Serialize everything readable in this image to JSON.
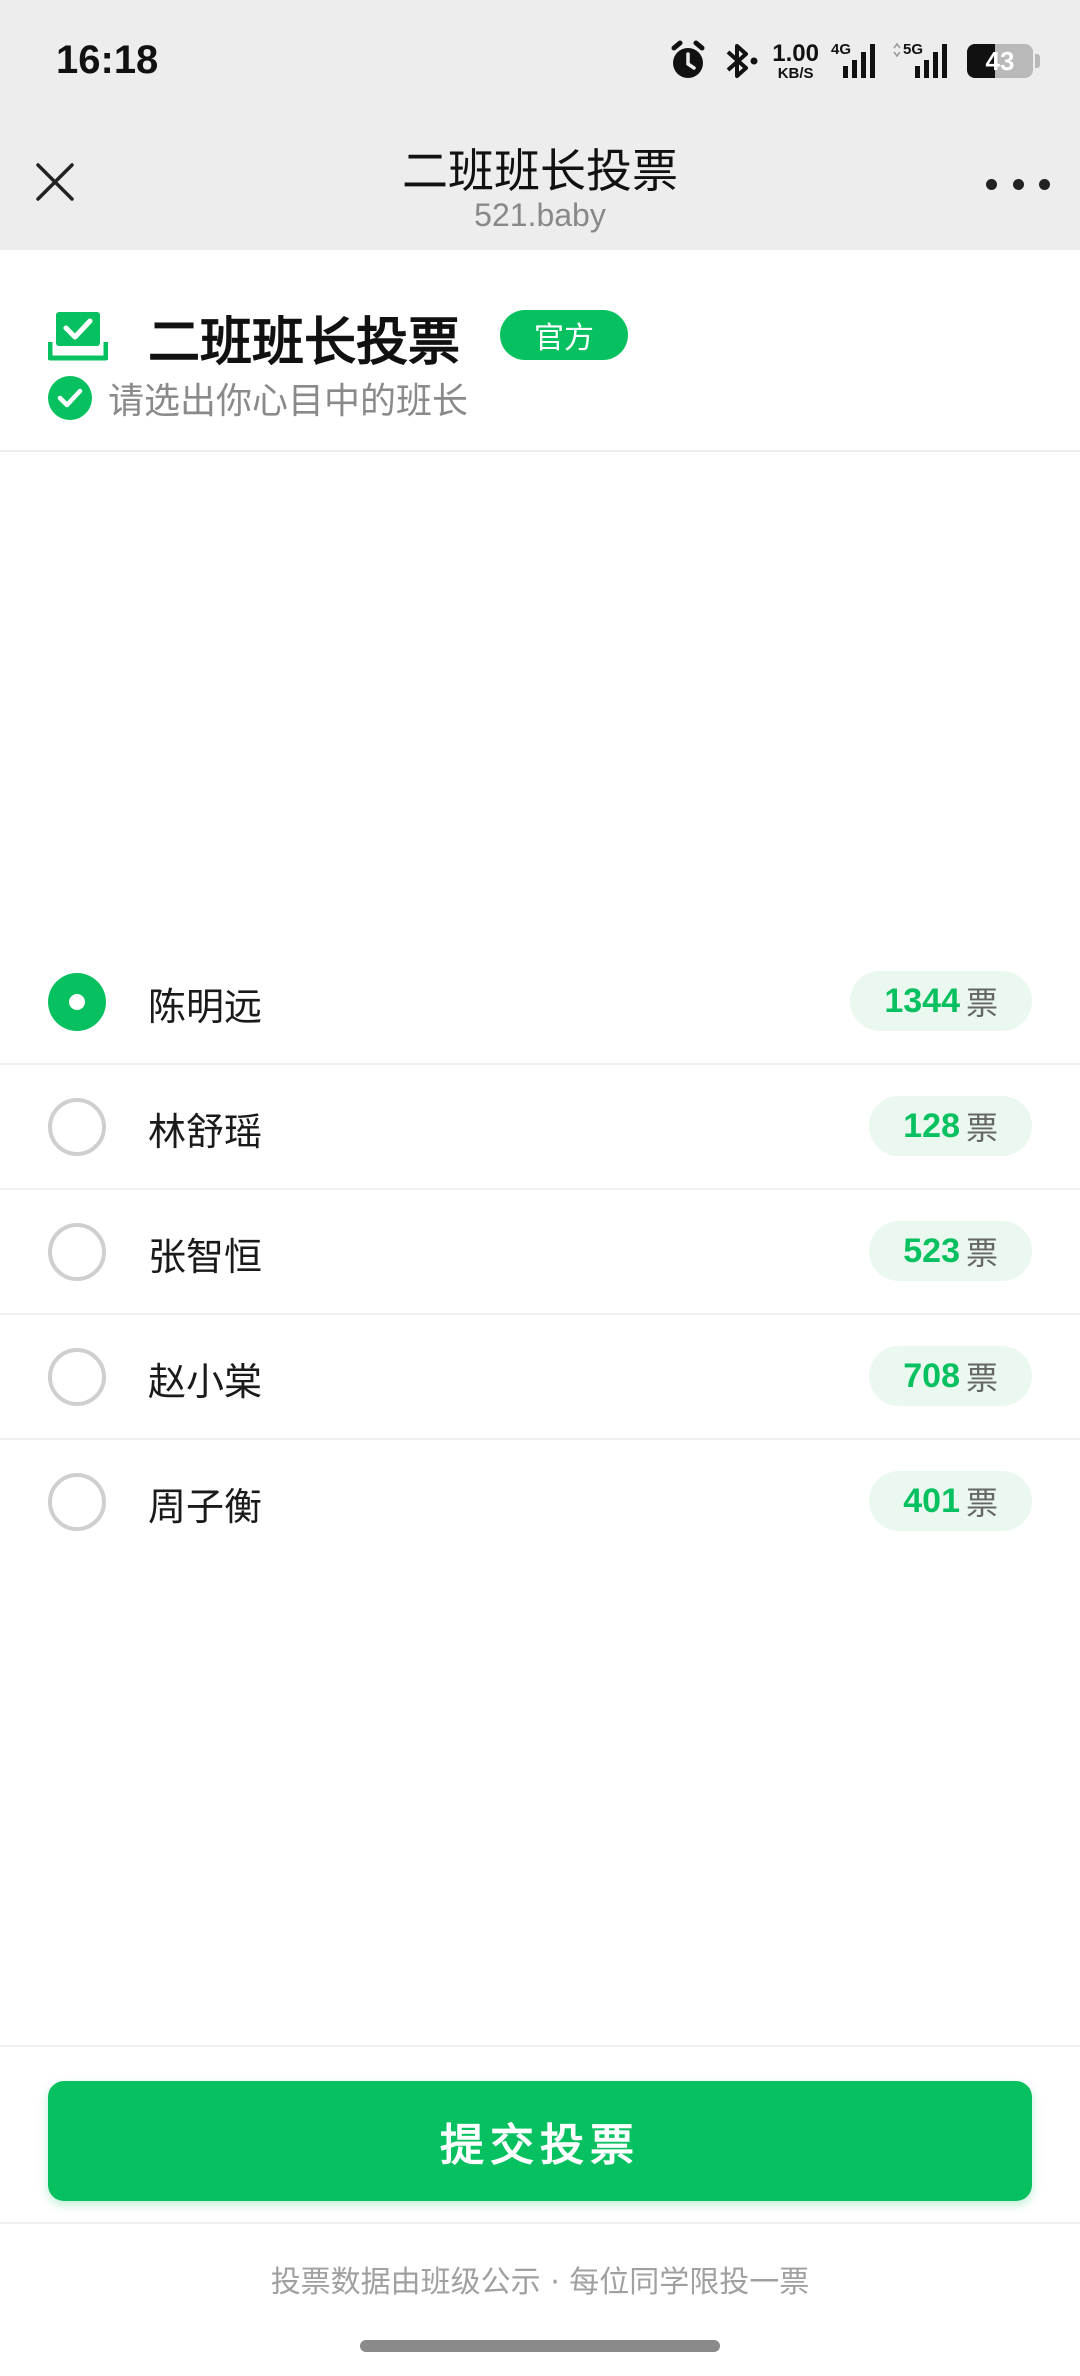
{
  "status_bar": {
    "time": "16:18",
    "net_speed_value": "1.00",
    "net_speed_unit": "KB/S",
    "signal_1": "4G",
    "signal_2": "5G",
    "battery": "43",
    "battery_level": 0.43,
    "icons": [
      "alarm-icon",
      "bluetooth-icon",
      "signal-icon",
      "battery-icon"
    ]
  },
  "title_bar": {
    "title": "二班班长投票",
    "subtitle": "521.baby"
  },
  "header": {
    "title": "二班班长投票",
    "badge": "官方",
    "subtitle": "请选出你心目中的班长"
  },
  "candidates": [
    {
      "name": "陈明远",
      "votes": "1344",
      "unit": "票",
      "selected": true
    },
    {
      "name": "林舒瑶",
      "votes": "128",
      "unit": "票",
      "selected": false
    },
    {
      "name": "张智恒",
      "votes": "523",
      "unit": "票",
      "selected": false
    },
    {
      "name": "赵小棠",
      "votes": "708",
      "unit": "票",
      "selected": false
    },
    {
      "name": "周子衡",
      "votes": "401",
      "unit": "票",
      "selected": false
    }
  ],
  "submit_label": "提交投票",
  "footer_note": "投票数据由班级公示 · 每位同学限投一票",
  "colors": {
    "accent": "#07c160",
    "pill_bg": "#eaf8ef",
    "bar_bg": "#ededed"
  }
}
